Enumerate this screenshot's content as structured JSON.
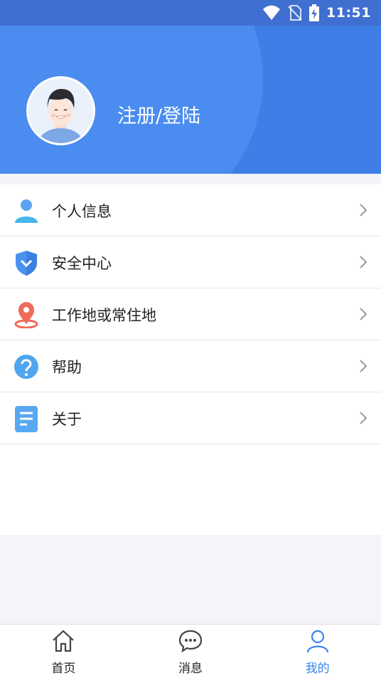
{
  "status_bar": {
    "time": "11:51"
  },
  "header": {
    "login_label": "注册/登陆"
  },
  "menu": {
    "items": [
      {
        "label": "个人信息",
        "icon": "person-icon"
      },
      {
        "label": "安全中心",
        "icon": "shield-icon"
      },
      {
        "label": "工作地或常住地",
        "icon": "location-pin-icon"
      },
      {
        "label": "帮助",
        "icon": "help-icon"
      },
      {
        "label": "关于",
        "icon": "document-icon"
      }
    ]
  },
  "tabbar": {
    "tabs": [
      {
        "label": "首页",
        "icon": "home-icon"
      },
      {
        "label": "消息",
        "icon": "chat-icon"
      },
      {
        "label": "我的",
        "icon": "profile-icon",
        "active": true
      }
    ]
  },
  "colors": {
    "header_blue": "#3f7ee6",
    "active_tab": "#3a87e8",
    "pin_red": "#ef6b5a"
  }
}
